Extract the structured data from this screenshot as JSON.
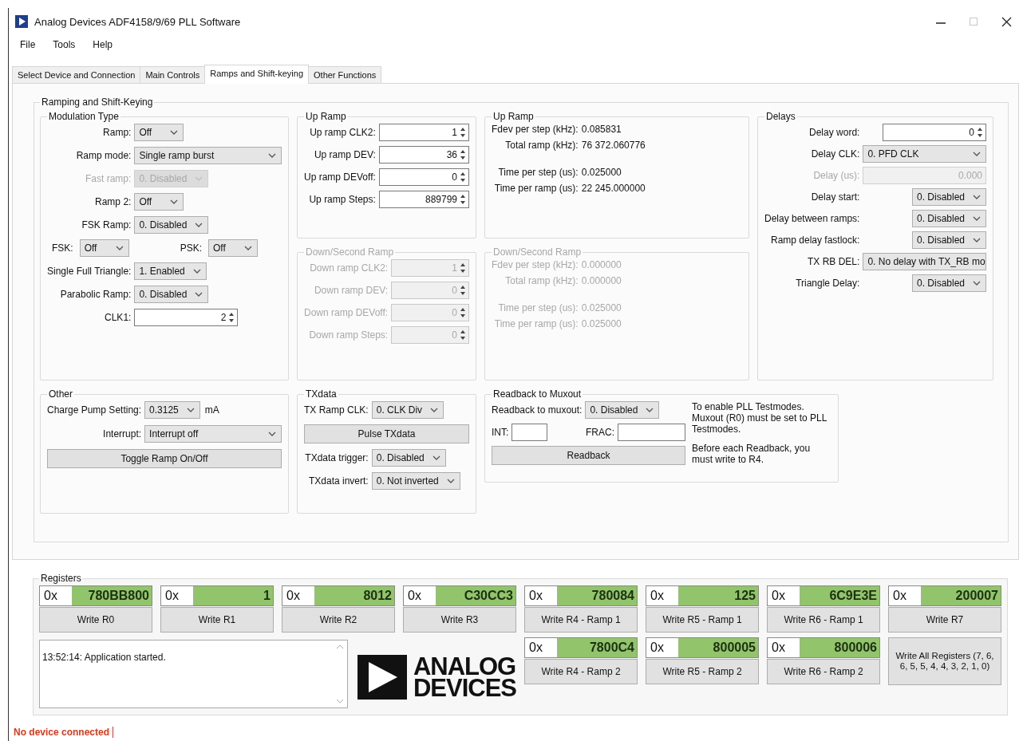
{
  "window": {
    "title": "Analog Devices ADF4158/9/69 PLL Software"
  },
  "menu": [
    "File",
    "Tools",
    "Help"
  ],
  "tabs": [
    {
      "label": "Select Device and Connection",
      "selected": false
    },
    {
      "label": "Main Controls",
      "selected": false
    },
    {
      "label": "Ramps and Shift-keying",
      "selected": true
    },
    {
      "label": "Other Functions",
      "selected": false
    }
  ],
  "panel_title": "Ramping and Shift-Keying",
  "groups": [
    {
      "title": "Modulation Type",
      "disabled": false,
      "rows": [
        {
          "kind": "combo",
          "label": "Ramp:",
          "value": "Off",
          "disabled": false
        },
        {
          "kind": "combo_wide",
          "label": "Ramp mode:",
          "value": "Single ramp burst",
          "disabled": false
        },
        {
          "kind": "combo",
          "label": "Fast ramp:",
          "value": "0. Disabled",
          "disabled": true
        },
        {
          "kind": "combo",
          "label": "Ramp 2:",
          "value": "Off",
          "disabled": false
        },
        {
          "kind": "combo",
          "label": "FSK Ramp:",
          "value": "0. Disabled",
          "disabled": false
        },
        {
          "kind": "pair",
          "disabled": false,
          "items": [
            {
              "label": "FSK:",
              "value": "Off"
            },
            {
              "label": "PSK:",
              "value": "Off"
            }
          ]
        },
        {
          "kind": "combo",
          "label": "Single Full Triangle:",
          "value": "1. Enabled",
          "disabled": false
        },
        {
          "kind": "combo",
          "label": "Parabolic Ramp:",
          "value": "0. Disabled",
          "disabled": false
        },
        {
          "kind": "spin",
          "label": "CLK1:",
          "value": "2",
          "disabled": false
        }
      ]
    },
    {
      "title": "Up Ramp",
      "disabled": false,
      "rows": [
        {
          "kind": "spin",
          "label": "Up ramp CLK2:",
          "value": "1",
          "disabled": false
        },
        {
          "kind": "spin",
          "label": "Up ramp DEV:",
          "value": "36",
          "disabled": false
        },
        {
          "kind": "spin",
          "label": "Up ramp DEVoff:",
          "value": "0",
          "disabled": false
        },
        {
          "kind": "spin",
          "label": "Up ramp Steps:",
          "value": "889799",
          "disabled": false
        }
      ]
    },
    {
      "title": "Up Ramp",
      "disabled": false,
      "rows": [
        {
          "kind": "info",
          "label": "Fdev per step (kHz):",
          "value": "0.085831",
          "disabled": false
        },
        {
          "kind": "info",
          "label": "Total ramp (kHz):",
          "value": "76 372.060776",
          "disabled": false
        },
        {
          "kind": "info",
          "label": "Time per step (us):",
          "value": "0.025000",
          "disabled": false
        },
        {
          "kind": "info",
          "label": "Time per ramp (us):",
          "value": "22 245.000000",
          "disabled": false
        }
      ]
    },
    {
      "title": "Delays",
      "disabled": false,
      "rows": [
        {
          "kind": "spin",
          "label": "Delay word:",
          "value": "0",
          "disabled": false
        },
        {
          "kind": "combo_wide",
          "label": "Delay CLK:",
          "value": "0. PFD CLK",
          "disabled": false
        },
        {
          "kind": "textbox",
          "label": "Delay (us):",
          "value": "0.000",
          "disabled": true
        },
        {
          "kind": "combo",
          "label": "Delay start:",
          "value": "0. Disabled",
          "disabled": false
        },
        {
          "kind": "combo",
          "label": "Delay between ramps:",
          "value": "0. Disabled",
          "disabled": false
        },
        {
          "kind": "combo",
          "label": "Ramp delay fastlock:",
          "value": "0. Disabled",
          "disabled": false
        },
        {
          "kind": "combo_wide",
          "label": "TX RB DEL:",
          "value": "0. No delay with TX_RB mo",
          "disabled": false
        },
        {
          "kind": "combo",
          "label": "Triangle Delay:",
          "value": "0. Disabled",
          "disabled": false
        }
      ]
    },
    {
      "title": "Down/Second Ramp",
      "disabled": true,
      "rows": [
        {
          "kind": "spin",
          "label": "Down ramp CLK2:",
          "value": "1",
          "disabled": true
        },
        {
          "kind": "spin",
          "label": "Down ramp DEV:",
          "value": "0",
          "disabled": true
        },
        {
          "kind": "spin",
          "label": "Down ramp DEVoff:",
          "value": "0",
          "disabled": true
        },
        {
          "kind": "spin",
          "label": "Down ramp Steps:",
          "value": "0",
          "disabled": true
        }
      ]
    },
    {
      "title": "Down/Second Ramp",
      "disabled": true,
      "rows": [
        {
          "kind": "info",
          "label": "Fdev per step (kHz):",
          "value": "0.000000",
          "disabled": true
        },
        {
          "kind": "info",
          "label": "Total ramp (kHz):",
          "value": "0.000000",
          "disabled": true
        },
        {
          "kind": "info",
          "label": "Time per step (us):",
          "value": "0.025000",
          "disabled": true
        },
        {
          "kind": "info",
          "label": "Time per ramp (us):",
          "value": "0.025000",
          "disabled": true
        }
      ]
    },
    {
      "title": "Other",
      "disabled": false,
      "rows": [
        {
          "kind": "combo",
          "label": "Charge Pump Setting:",
          "value": "0.3125",
          "unit": "mA",
          "disabled": false
        },
        {
          "kind": "combo_wide",
          "label": "Interrupt:",
          "value": "Interrupt off",
          "disabled": false
        },
        {
          "kind": "button",
          "label": "Toggle Ramp On/Off",
          "disabled": false
        }
      ]
    },
    {
      "title": "TXdata",
      "disabled": false,
      "rows": [
        {
          "kind": "combo",
          "label": "TX Ramp CLK:",
          "value": "0. CLK Div",
          "disabled": false
        },
        {
          "kind": "button",
          "label": "Pulse TXdata",
          "disabled": false
        },
        {
          "kind": "combo",
          "label": "TXdata trigger:",
          "value": "0. Disabled",
          "disabled": false
        },
        {
          "kind": "combo",
          "label": "TXdata invert:",
          "value": "0. Not inverted",
          "disabled": false
        }
      ]
    },
    {
      "title": "Readback to Muxout",
      "disabled": false,
      "rows": [
        {
          "kind": "combo",
          "label": "Readback to muxout:",
          "value": "0. Disabled",
          "disabled": false
        },
        {
          "kind": "fields",
          "disabled": false,
          "items": [
            {
              "label": "INT:"
            },
            {
              "label": "FRAC:"
            }
          ]
        },
        {
          "kind": "button",
          "label": "Readback",
          "disabled": false
        }
      ],
      "notes": [
        "To enable PLL Testmodes. Muxout (R0) must be set to PLL Testmodes.",
        "Before each Readback, you must write to R4."
      ]
    }
  ],
  "registers": {
    "title": "Registers",
    "items": [
      {
        "prefix": "0x",
        "value": "780BB800",
        "button": "Write R0"
      },
      {
        "prefix": "0x",
        "value": "1",
        "button": "Write R1"
      },
      {
        "prefix": "0x",
        "value": "8012",
        "button": "Write R2"
      },
      {
        "prefix": "0x",
        "value": "C30CC3",
        "button": "Write R3"
      },
      {
        "prefix": "0x",
        "value": "780084",
        "button": "Write R4 - Ramp 1"
      },
      {
        "prefix": "0x",
        "value": "125",
        "button": "Write R5 - Ramp 1"
      },
      {
        "prefix": "0x",
        "value": "6C9E3E",
        "button": "Write R6 - Ramp 1"
      },
      {
        "prefix": "0x",
        "value": "200007",
        "button": "Write R7"
      }
    ],
    "ramp2_items": [
      {
        "prefix": "0x",
        "value": "7800C4",
        "button": "Write R4 - Ramp 2"
      },
      {
        "prefix": "0x",
        "value": "800005",
        "button": "Write R5 - Ramp 2"
      },
      {
        "prefix": "0x",
        "value": "800006",
        "button": "Write R6 - Ramp 2"
      }
    ],
    "write_all_button": "Write All Registers (7, 6, 6, 5, 5, 4, 4, 3, 2, 1, 0)"
  },
  "log": {
    "lines": [
      "13:52:14: Application started."
    ]
  },
  "logo": {
    "lines": [
      "ANALOG",
      "DEVICES"
    ]
  },
  "status_bar": {
    "text": "No device connected"
  }
}
